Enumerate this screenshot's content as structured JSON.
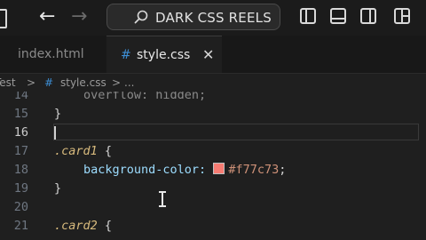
{
  "titlebar": {
    "search_text": "DARK CSS REELS",
    "back_icon": "arrow-left-icon",
    "forward_icon": "arrow-right-icon"
  },
  "tabs": [
    {
      "label": "index.html",
      "active": false
    },
    {
      "label": "style.css",
      "active": true,
      "close_glyph": "✕"
    }
  ],
  "breadcrumb": {
    "parts": [
      "Test",
      ">",
      "#",
      "style.css",
      ">",
      "..."
    ]
  },
  "editor": {
    "lines": [
      {
        "number": "14",
        "text": "overflow: hidden;"
      },
      {
        "number": "15",
        "text": "}"
      },
      {
        "number": "16",
        "text": ""
      },
      {
        "number": "17",
        "selector": ".card1",
        "brace": "{"
      },
      {
        "number": "18",
        "property": "background-color:",
        "value": "#f77c73",
        "end": ";"
      },
      {
        "number": "19",
        "text": "}"
      },
      {
        "number": "20",
        "text": ""
      },
      {
        "number": "21",
        "selector": ".card2",
        "brace": "{"
      }
    ],
    "swatch_color": "#f77c73",
    "active_line": "16"
  },
  "colors": {
    "selector": "#d7ba7d",
    "property": "#9cdcfe",
    "value": "#ce9178",
    "html_file": "#e37933",
    "css_file": "#3d8fd6"
  }
}
